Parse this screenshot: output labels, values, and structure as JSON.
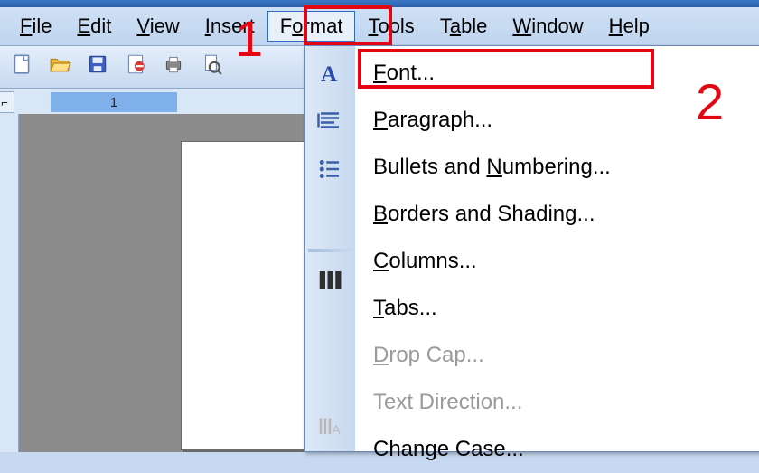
{
  "menubar": {
    "items": [
      {
        "label": "File",
        "mn": "F",
        "rest": "ile"
      },
      {
        "label": "Edit",
        "mn": "E",
        "rest": "dit"
      },
      {
        "label": "View",
        "mn": "V",
        "rest": "iew"
      },
      {
        "label": "Insert",
        "mn": "I",
        "rest": "nsert"
      },
      {
        "label": "Format",
        "mn": "o",
        "pre": "F",
        "rest": "rmat"
      },
      {
        "label": "Tools",
        "mn": "T",
        "rest": "ools"
      },
      {
        "label": "Table",
        "mn": "a",
        "pre": "T",
        "rest": "ble"
      },
      {
        "label": "Window",
        "mn": "W",
        "rest": "indow"
      },
      {
        "label": "Help",
        "mn": "H",
        "rest": "elp"
      }
    ]
  },
  "toolbar": {
    "icons": [
      "new-doc-icon",
      "open-icon",
      "save-icon",
      "permission-icon",
      "print-icon",
      "print-preview-icon"
    ]
  },
  "ruler": {
    "label": "1"
  },
  "dropdown": {
    "items": [
      {
        "label": "Font...",
        "mn": "F",
        "rest": "ont...",
        "icon": "font-a-icon",
        "disabled": false
      },
      {
        "label": "Paragraph...",
        "mn": "P",
        "rest": "aragraph...",
        "icon": "paragraph-lines-icon",
        "disabled": false
      },
      {
        "label": "Bullets and Numbering...",
        "mn": "N",
        "pre": "Bullets and ",
        "rest": "umbering...",
        "icon": "bullets-icon",
        "disabled": false
      },
      {
        "label": "Borders and Shading...",
        "mn": "B",
        "rest": "orders and Shading...",
        "icon": "",
        "disabled": false
      },
      {
        "label": "Columns...",
        "mn": "C",
        "rest": "olumns...",
        "icon": "columns-icon",
        "disabled": false,
        "sepBefore": true
      },
      {
        "label": "Tabs...",
        "mn": "T",
        "rest": "abs...",
        "icon": "",
        "disabled": false
      },
      {
        "label": "Drop Cap...",
        "mn": "D",
        "rest": "rop Cap...",
        "icon": "",
        "disabled": true
      },
      {
        "label": "Text Direction...",
        "mn": "",
        "rest": "Text Direction...",
        "icon": "text-direction-icon",
        "disabled": true
      },
      {
        "label": "Change Case...",
        "mn": "",
        "rest": "Change Case...",
        "icon": "",
        "disabled": false
      }
    ]
  },
  "annotations": {
    "num1": "1",
    "num2": "2"
  }
}
